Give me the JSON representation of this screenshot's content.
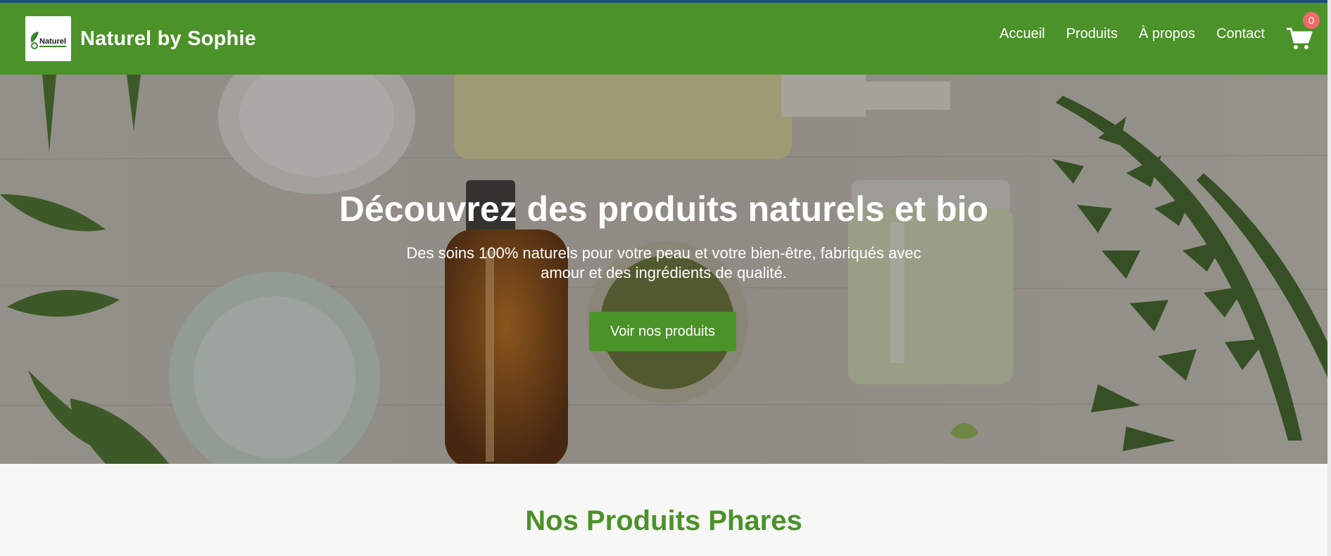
{
  "header": {
    "brand_name": "Naturel by Sophie",
    "logo_text": "Naturel",
    "background_color": "#4b9229",
    "nav": [
      {
        "label": "Accueil"
      },
      {
        "label": "Produits"
      },
      {
        "label": "À propos"
      },
      {
        "label": "Contact"
      }
    ],
    "cart": {
      "icon": "cart-icon",
      "count": "0",
      "badge_color": "#f06a6a"
    }
  },
  "hero": {
    "title": "Découvrez des produits naturels et bio",
    "subtitle": "Des soins 100% naturels pour votre peau et votre bien-être, fabriqués avec amour et des ingrédients de qualité.",
    "cta_label": "Voir nos produits",
    "cta_color": "#4b9229"
  },
  "featured": {
    "title": "Nos Produits Phares",
    "title_color": "#4b9229"
  }
}
